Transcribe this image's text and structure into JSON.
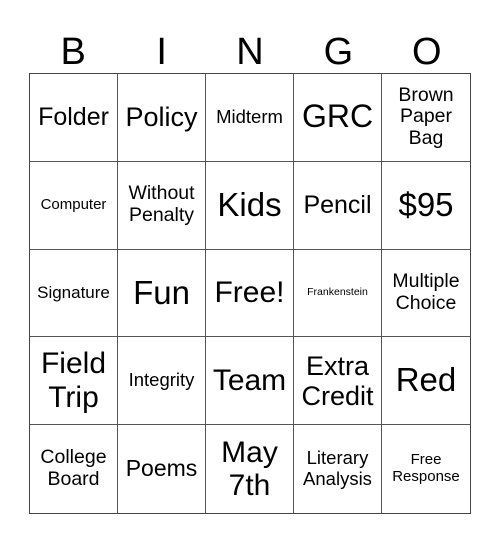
{
  "header": {
    "letters": [
      "B",
      "I",
      "N",
      "G",
      "O"
    ]
  },
  "cells": [
    [
      "Folder",
      "Policy",
      "Midterm",
      "GRC",
      "Brown Paper Bag"
    ],
    [
      "Computer",
      "Without Penalty",
      "Kids",
      "Pencil",
      "$95"
    ],
    [
      "Signature",
      "Fun",
      "Free!",
      "Frankenstein",
      "Multiple Choice"
    ],
    [
      "Field Trip",
      "Integrity",
      "Team",
      "Extra Credit",
      "Red"
    ],
    [
      "College Board",
      "Poems",
      "May 7th",
      "Literary Analysis",
      "Free Response"
    ]
  ]
}
